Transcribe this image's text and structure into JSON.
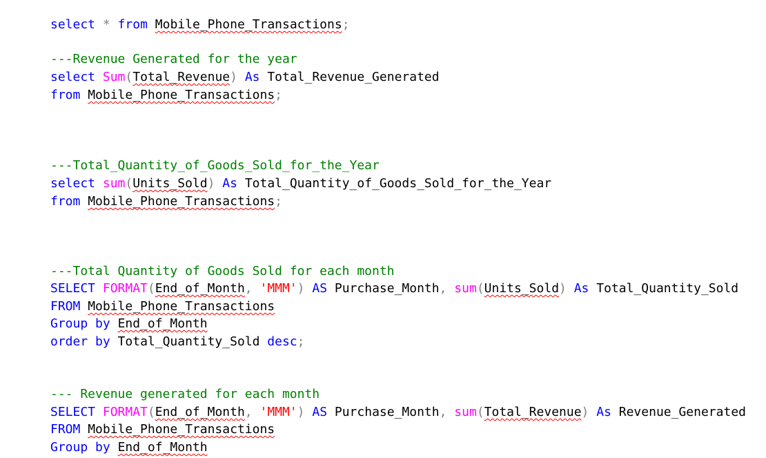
{
  "editor": {
    "colors": {
      "keyword": "#0000ff",
      "function": "#ff00ff",
      "string": "#ff0000",
      "operator": "#808080",
      "comment": "#008000",
      "identifier": "#000000",
      "squiggle": "#ff0000"
    },
    "lines": [
      {
        "tokens": [
          {
            "t": "select",
            "c": "kw"
          },
          {
            "t": " ",
            "c": "id"
          },
          {
            "t": "*",
            "c": "op"
          },
          {
            "t": " ",
            "c": "id"
          },
          {
            "t": "from",
            "c": "kw"
          },
          {
            "t": " ",
            "c": "id"
          },
          {
            "t": "Mobile_Phone_Transactions",
            "c": "id",
            "sq": true
          },
          {
            "t": ";",
            "c": "op"
          }
        ]
      },
      {
        "tokens": [
          {
            "t": "---Revenue Generated for the year",
            "c": "cm"
          }
        ]
      },
      {
        "tokens": [
          {
            "t": "select",
            "c": "kw"
          },
          {
            "t": " ",
            "c": "id"
          },
          {
            "t": "Sum",
            "c": "fn"
          },
          {
            "t": "(",
            "c": "op"
          },
          {
            "t": "Total_Revenue",
            "c": "id",
            "sq": true
          },
          {
            "t": ")",
            "c": "op"
          },
          {
            "t": " ",
            "c": "id"
          },
          {
            "t": "As",
            "c": "kw"
          },
          {
            "t": " Total_Revenue_Generated",
            "c": "id"
          }
        ]
      },
      {
        "tokens": [
          {
            "t": "from",
            "c": "kw"
          },
          {
            "t": " ",
            "c": "id"
          },
          {
            "t": "Mobile_Phone_Transactions",
            "c": "id",
            "sq": true
          },
          {
            "t": ";",
            "c": "op"
          }
        ]
      },
      {
        "tokens": [
          {
            "t": "---Total_Quantity_of_Goods_Sold_for_the_Year",
            "c": "cm"
          }
        ]
      },
      {
        "tokens": [
          {
            "t": "select",
            "c": "kw"
          },
          {
            "t": " ",
            "c": "id"
          },
          {
            "t": "sum",
            "c": "fn"
          },
          {
            "t": "(",
            "c": "op"
          },
          {
            "t": "Units_Sold",
            "c": "id",
            "sq": true
          },
          {
            "t": ")",
            "c": "op"
          },
          {
            "t": " ",
            "c": "id"
          },
          {
            "t": "As",
            "c": "kw"
          },
          {
            "t": " Total_Quantity_of_Goods_Sold_for_the_Year",
            "c": "id"
          }
        ]
      },
      {
        "tokens": [
          {
            "t": "from",
            "c": "kw"
          },
          {
            "t": " ",
            "c": "id"
          },
          {
            "t": "Mobile_Phone_Transactions",
            "c": "id",
            "sq": true
          },
          {
            "t": ";",
            "c": "op"
          }
        ]
      },
      {
        "tokens": [
          {
            "t": "---Total Quantity of Goods Sold for each month",
            "c": "cm"
          }
        ]
      },
      {
        "tokens": [
          {
            "t": "SELECT",
            "c": "kw"
          },
          {
            "t": " ",
            "c": "id"
          },
          {
            "t": "FORMAT",
            "c": "fn"
          },
          {
            "t": "(",
            "c": "op"
          },
          {
            "t": "End_of_Month",
            "c": "id",
            "sq": true
          },
          {
            "t": ",",
            "c": "op"
          },
          {
            "t": " ",
            "c": "id"
          },
          {
            "t": "'MMM'",
            "c": "str"
          },
          {
            "t": ")",
            "c": "op"
          },
          {
            "t": " ",
            "c": "id"
          },
          {
            "t": "AS",
            "c": "kw"
          },
          {
            "t": " Purchase_Month",
            "c": "id"
          },
          {
            "t": ",",
            "c": "op"
          },
          {
            "t": " ",
            "c": "id"
          },
          {
            "t": "sum",
            "c": "fn"
          },
          {
            "t": "(",
            "c": "op"
          },
          {
            "t": "Units_Sold",
            "c": "id",
            "sq": true
          },
          {
            "t": ")",
            "c": "op"
          },
          {
            "t": " ",
            "c": "id"
          },
          {
            "t": "As",
            "c": "kw"
          },
          {
            "t": " Total_Quantity_Sold",
            "c": "id"
          }
        ]
      },
      {
        "tokens": [
          {
            "t": "FROM",
            "c": "kw"
          },
          {
            "t": " ",
            "c": "id"
          },
          {
            "t": "Mobile_Phone_Transactions",
            "c": "id",
            "sq": true
          }
        ]
      },
      {
        "tokens": [
          {
            "t": "Group",
            "c": "kw"
          },
          {
            "t": " ",
            "c": "id"
          },
          {
            "t": "by",
            "c": "kw"
          },
          {
            "t": " ",
            "c": "id"
          },
          {
            "t": "End_of_Month",
            "c": "id",
            "sq": true
          }
        ]
      },
      {
        "tokens": [
          {
            "t": "order",
            "c": "kw"
          },
          {
            "t": " ",
            "c": "id"
          },
          {
            "t": "by",
            "c": "kw"
          },
          {
            "t": " Total_Quantity_Sold ",
            "c": "id"
          },
          {
            "t": "desc",
            "c": "kw"
          },
          {
            "t": ";",
            "c": "op"
          }
        ]
      },
      {
        "tokens": [
          {
            "t": "--- Revenue generated for each month",
            "c": "cm"
          }
        ]
      },
      {
        "tokens": [
          {
            "t": "SELECT",
            "c": "kw"
          },
          {
            "t": " ",
            "c": "id"
          },
          {
            "t": "FORMAT",
            "c": "fn"
          },
          {
            "t": "(",
            "c": "op"
          },
          {
            "t": "End_of_Month",
            "c": "id",
            "sq": true
          },
          {
            "t": ",",
            "c": "op"
          },
          {
            "t": " ",
            "c": "id"
          },
          {
            "t": "'MMM'",
            "c": "str"
          },
          {
            "t": ")",
            "c": "op"
          },
          {
            "t": " ",
            "c": "id"
          },
          {
            "t": "AS",
            "c": "kw"
          },
          {
            "t": " Purchase_Month",
            "c": "id"
          },
          {
            "t": ",",
            "c": "op"
          },
          {
            "t": " ",
            "c": "id"
          },
          {
            "t": "sum",
            "c": "fn"
          },
          {
            "t": "(",
            "c": "op"
          },
          {
            "t": "Total_Revenue",
            "c": "id",
            "sq": true
          },
          {
            "t": ")",
            "c": "op"
          },
          {
            "t": " ",
            "c": "id"
          },
          {
            "t": "As",
            "c": "kw"
          },
          {
            "t": " Revenue_Generated",
            "c": "id"
          }
        ]
      },
      {
        "tokens": [
          {
            "t": "FROM",
            "c": "kw"
          },
          {
            "t": " ",
            "c": "id"
          },
          {
            "t": "Mobile_Phone_Transactions",
            "c": "id",
            "sq": true
          }
        ]
      },
      {
        "tokens": [
          {
            "t": "Group",
            "c": "kw"
          },
          {
            "t": " ",
            "c": "id"
          },
          {
            "t": "by",
            "c": "kw"
          },
          {
            "t": " ",
            "c": "id"
          },
          {
            "t": "End_of_Month",
            "c": "id",
            "sq": true
          }
        ]
      }
    ]
  }
}
